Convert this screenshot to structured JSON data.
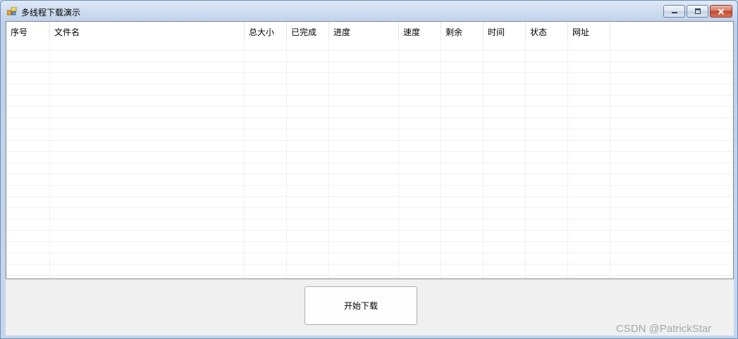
{
  "window": {
    "title": "多线程下载演示"
  },
  "list": {
    "columns": [
      "序号",
      "文件名",
      "总大小",
      "已完成",
      "进度",
      "速度",
      "剩余",
      "时间",
      "状态",
      "网址"
    ]
  },
  "actions": {
    "start_label": "开始下载"
  },
  "watermark": "CSDN @PatrickStar"
}
